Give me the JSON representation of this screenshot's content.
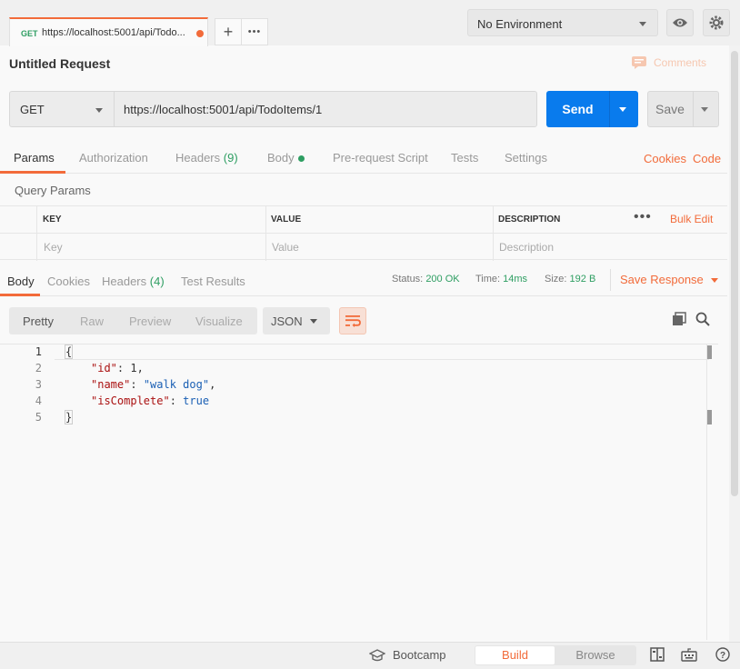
{
  "tab": {
    "method": "GET",
    "title": "https://localhost:5001/api/Todo..."
  },
  "tab_actions": {
    "add": "+",
    "more": "•••"
  },
  "environment": {
    "selected": "No Environment"
  },
  "request": {
    "title": "Untitled Request",
    "comments_label": "Comments",
    "method": "GET",
    "url": "https://localhost:5001/api/TodoItems/1",
    "send_label": "Send",
    "save_label": "Save"
  },
  "request_tabs": {
    "params": "Params",
    "authorization": "Authorization",
    "headers": "Headers",
    "headers_count": "(9)",
    "body": "Body",
    "pre_request": "Pre-request Script",
    "tests": "Tests",
    "settings": "Settings",
    "cookies": "Cookies",
    "code": "Code"
  },
  "query_params": {
    "title": "Query Params",
    "columns": [
      "KEY",
      "VALUE",
      "DESCRIPTION"
    ],
    "placeholders": [
      "Key",
      "Value",
      "Description"
    ],
    "bulk_edit": "Bulk Edit",
    "more": "•••"
  },
  "response_tabs": {
    "body": "Body",
    "cookies": "Cookies",
    "headers": "Headers",
    "headers_count": "(4)",
    "test_results": "Test Results"
  },
  "response_status": {
    "status_label": "Status:",
    "status_value": "200 OK",
    "time_label": "Time:",
    "time_value": "14ms",
    "size_label": "Size:",
    "size_value": "192 B",
    "save_response": "Save Response"
  },
  "view_modes": [
    "Pretty",
    "Raw",
    "Preview",
    "Visualize"
  ],
  "format": "JSON",
  "code": {
    "line_numbers": [
      "1",
      "2",
      "3",
      "4",
      "5"
    ],
    "open_brace": "{",
    "close_brace": "}",
    "entries": [
      {
        "key": "\"id\"",
        "value": "1"
      },
      {
        "key": "\"name\"",
        "value": "\"walk dog\""
      },
      {
        "key": "\"isComplete\"",
        "value": "true"
      }
    ]
  },
  "bottom_bar": {
    "bootcamp": "Bootcamp",
    "build": "Build",
    "browse": "Browse"
  },
  "icons": {
    "eye": "eye-icon",
    "gear": "gear-icon",
    "comment": "comment-icon",
    "wrap": "wrap-lines-icon",
    "copy": "copy-icon",
    "search": "search-icon",
    "bootcamp": "graduation-cap-icon",
    "two_pane": "two-pane-icon",
    "keyboard": "keyboard-icon",
    "help": "help-icon"
  },
  "colors": {
    "accent": "#f26b3a",
    "send": "#097bed",
    "success": "#2e9e62"
  }
}
